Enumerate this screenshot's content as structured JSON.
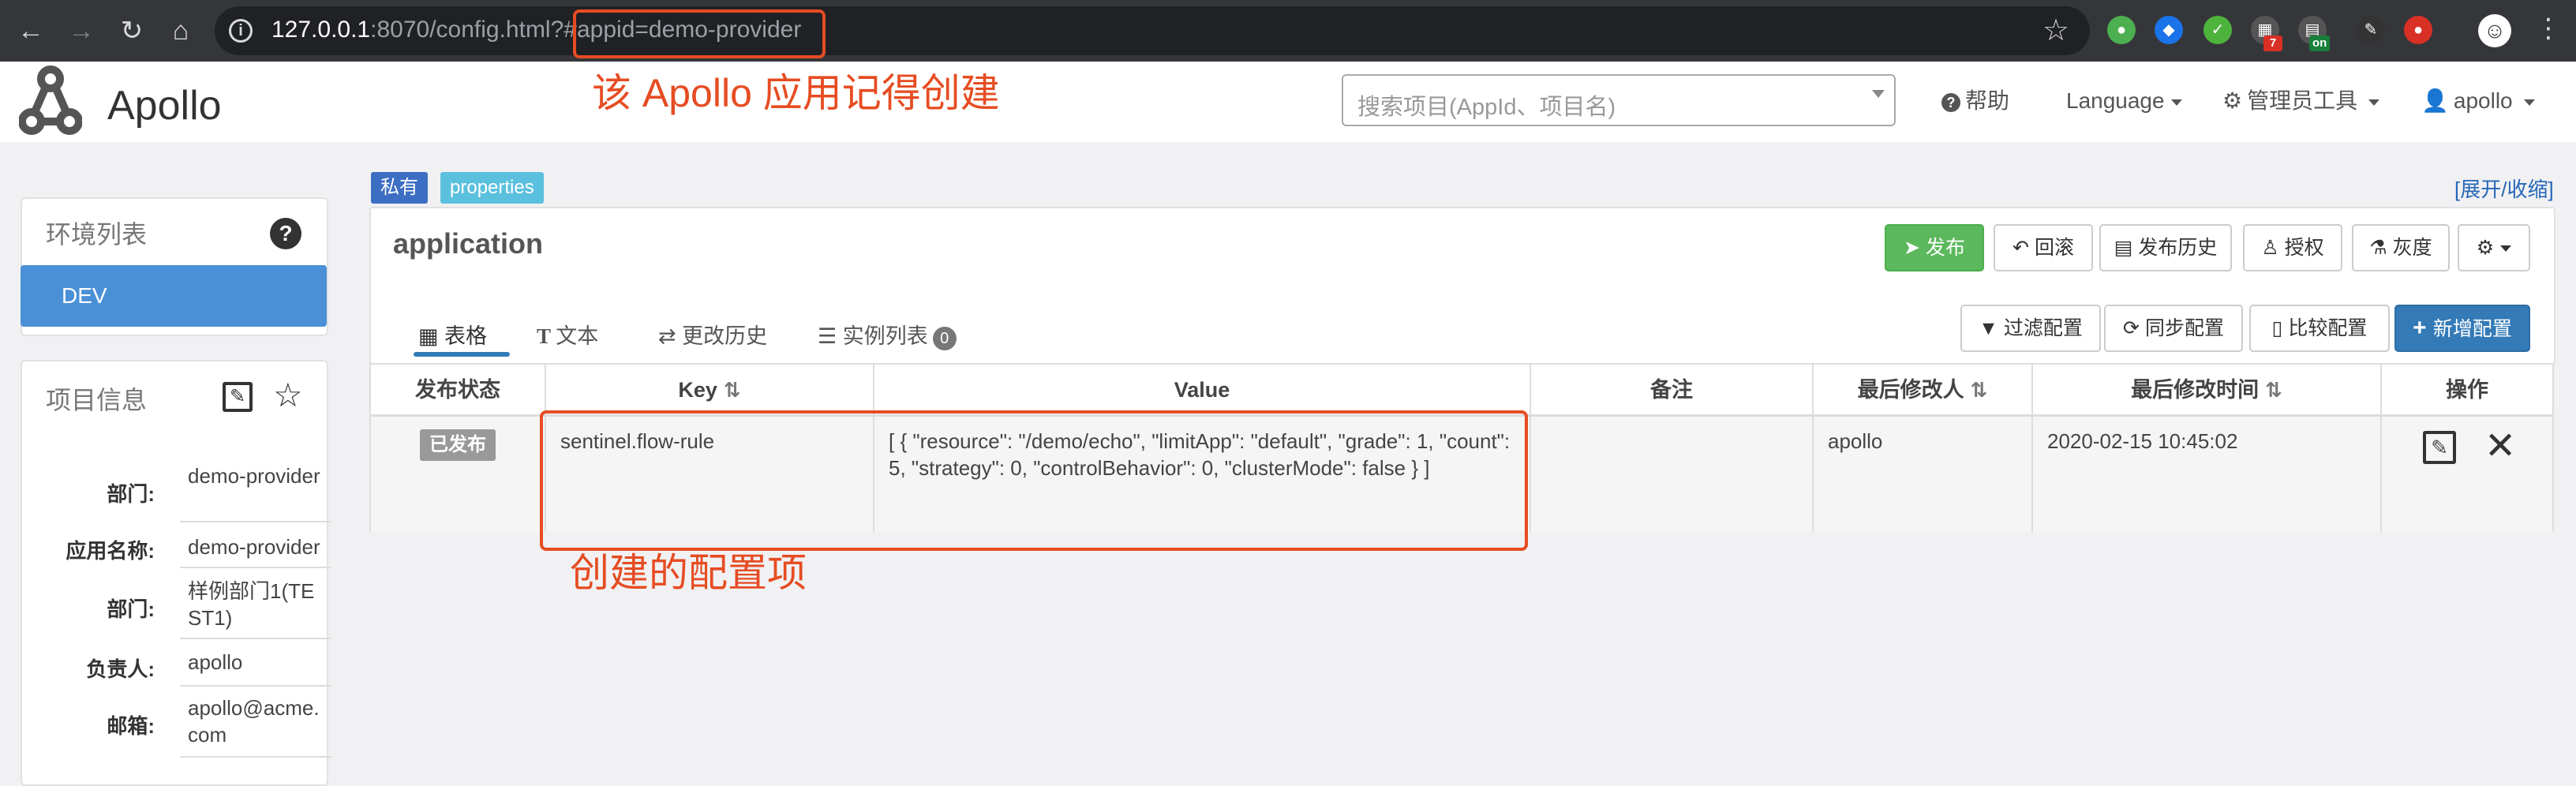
{
  "browser": {
    "url_host": "127.0.0.1",
    "url_rest": ":8070/config.html?#",
    "url_fragment": "appid=demo-provider",
    "extension_badges": [
      "7",
      "on"
    ]
  },
  "annotations": {
    "appid_note": "该 Apollo 应用记得创建",
    "config_note": "创建的配置项"
  },
  "header": {
    "brand": "Apollo",
    "search_placeholder": "搜索项目(AppId、项目名)",
    "help": "帮助",
    "language": "Language",
    "admin_tools": "管理员工具",
    "user": "apollo"
  },
  "sidebar": {
    "env_title": "环境列表",
    "envs": [
      "DEV"
    ],
    "project_title": "项目信息",
    "project_fields": [
      {
        "label": "部门:",
        "value": "demo-provider"
      },
      {
        "label": "应用名称:",
        "value": "demo-provider"
      },
      {
        "label": "部门:",
        "value": "样例部门1(TEST1)"
      },
      {
        "label": "负责人:",
        "value": "apollo"
      },
      {
        "label": "邮箱:",
        "value": "apollo@acme.com"
      }
    ]
  },
  "namespace": {
    "scope_label": "私有",
    "format_label": "properties",
    "expand_link": "[展开/收缩]",
    "name": "application",
    "actions": {
      "publish": "发布",
      "rollback": "回滚",
      "history": "发布历史",
      "grant": "授权",
      "gray": "灰度"
    },
    "tabs": {
      "table": "表格",
      "text": "文本",
      "change_history": "更改历史",
      "instances": "实例列表",
      "instances_count": "0"
    },
    "tools": {
      "filter": "过滤配置",
      "sync": "同步配置",
      "diff": "比较配置",
      "add": "新增配置"
    },
    "table": {
      "headers": {
        "status": "发布状态",
        "key": "Key",
        "value": "Value",
        "comment": "备注",
        "modifier": "最后修改人",
        "modified_time": "最后修改时间",
        "ops": "操作"
      },
      "rows": [
        {
          "status": "已发布",
          "key": "sentinel.flow-rule",
          "value": "[ { \"resource\": \"/demo/echo\", \"limitApp\": \"default\", \"grade\": 1, \"count\": 5, \"strategy\": 0, \"controlBehavior\": 0, \"clusterMode\": false } ]",
          "comment": "",
          "modifier": "apollo",
          "modified_time": "2020-02-15 10:45:02"
        }
      ]
    }
  },
  "colors": {
    "annotation_red": "#e64c22",
    "primary": "#337ab7",
    "success": "#5cb85c",
    "env_active": "#4a90d6"
  }
}
